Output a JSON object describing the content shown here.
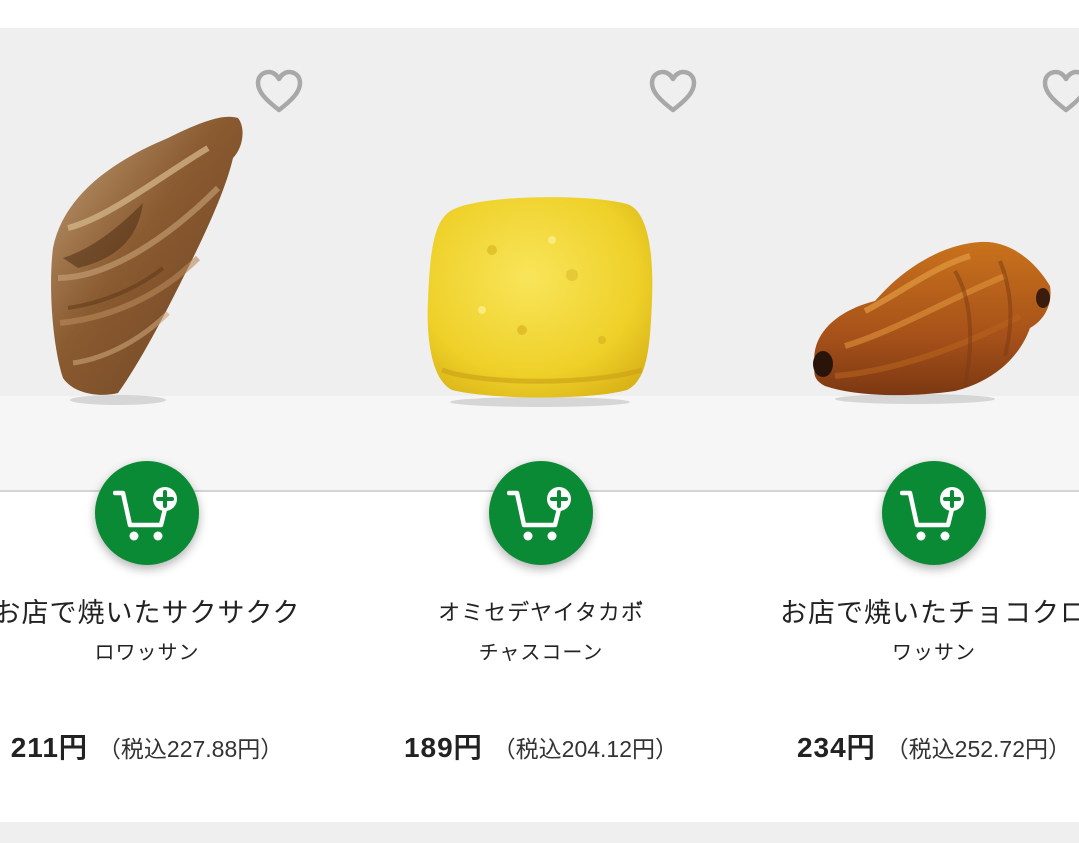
{
  "colors": {
    "cart_button": "#0b8a35",
    "shelf_background": "#efefef",
    "text": "#222222",
    "heart_outline": "#a8a8a8"
  },
  "products": [
    {
      "name_line1": "お店で焼いたサクサクク",
      "name_line2": "ロワッサン",
      "price": "211円",
      "price_tax": "（税込227.88円）",
      "image": "croissant",
      "favorite_icon": "heart-outline-icon",
      "cart_icon": "cart-plus-icon"
    },
    {
      "name_line1": "オミセデ゙ヤイタカボ゙",
      "name_line2": "チャスコーン",
      "price": "189円",
      "price_tax": "（税込204.12円）",
      "image": "pumpkin-scone",
      "favorite_icon": "heart-outline-icon",
      "cart_icon": "cart-plus-icon"
    },
    {
      "name_line1": "お店で焼いたチョコクロ",
      "name_line2": "ワッサン",
      "price": "234円",
      "price_tax": "（税込252.72円）",
      "image": "chocolate-croissant",
      "favorite_icon": "heart-outline-icon",
      "cart_icon": "cart-plus-icon"
    }
  ]
}
